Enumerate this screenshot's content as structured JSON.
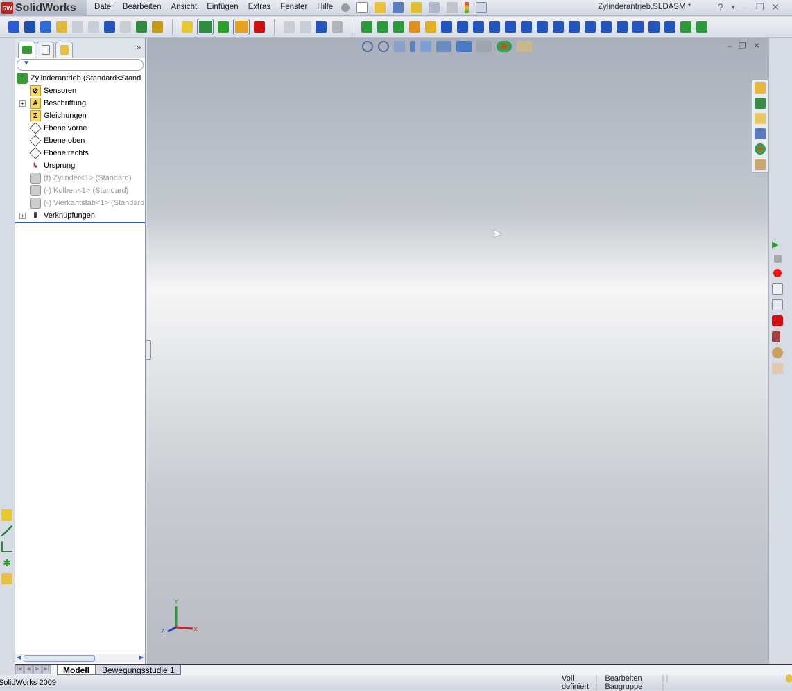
{
  "app": {
    "name": "SolidWorks",
    "logo": "SW",
    "document_title": "Zylinderantrieb.SLDASM *"
  },
  "menu": [
    "Datei",
    "Bearbeiten",
    "Ansicht",
    "Einfügen",
    "Extras",
    "Fenster",
    "Hilfe"
  ],
  "title_controls": {
    "help": "?",
    "minimize": "–",
    "maximize": "☐",
    "close": "✕"
  },
  "toolbar_icons": [
    {
      "name": "spell-check-icon",
      "color": "#2a5bd7"
    },
    {
      "name": "measure-icon",
      "color": "#1d4fb0"
    },
    {
      "name": "mass-properties-icon",
      "color": "#2f6ad9"
    },
    {
      "name": "section-properties-icon",
      "color": "#e0b83a"
    },
    {
      "name": "check-icon",
      "color": "#c8ccd4"
    },
    {
      "name": "costing-icon",
      "color": "#c8ccd4"
    },
    {
      "name": "sum-icon",
      "color": "#2355c0"
    },
    {
      "name": "interference-icon",
      "color": "#c8ccd4"
    },
    {
      "name": "bom-icon",
      "color": "#2f8b3f"
    },
    {
      "name": "analysis-icon",
      "color": "#c79a1a"
    },
    {
      "sep": true
    },
    {
      "name": "snap-icon",
      "color": "#e8c830"
    },
    {
      "name": "line-icon",
      "color": "#2f8b3f",
      "active": true
    },
    {
      "name": "point-icon",
      "color": "#2aa02a"
    },
    {
      "name": "sketch-icon",
      "color": "#e8a020",
      "active": true
    },
    {
      "name": "record-icon",
      "color": "#d01010"
    },
    {
      "sep": true
    },
    {
      "name": "filter-icon",
      "color": "#c8ccd4"
    },
    {
      "name": "filter-all-icon",
      "color": "#c8ccd4"
    },
    {
      "name": "filter-toggle-icon",
      "color": "#2355c0"
    },
    {
      "name": "select-icon",
      "color": "#b0b4bc"
    },
    {
      "sep": true
    },
    {
      "name": "filter-vertex-icon",
      "color": "#2a9a3a"
    },
    {
      "name": "filter-edge-icon",
      "color": "#2a9a3a"
    },
    {
      "name": "filter-face-icon",
      "color": "#2a9a3a"
    },
    {
      "name": "filter-surface-icon",
      "color": "#e09020"
    },
    {
      "name": "filter-body-icon",
      "color": "#e0b020"
    },
    {
      "name": "filter-axis-icon",
      "color": "#2355c0"
    },
    {
      "name": "filter-plane-icon",
      "color": "#2355c0"
    },
    {
      "name": "filter-point-icon",
      "color": "#2355c0"
    },
    {
      "name": "filter-dimension-icon",
      "color": "#2355c0"
    },
    {
      "name": "filter-note-icon",
      "color": "#2355c0"
    },
    {
      "name": "filter-balloon-icon",
      "color": "#2355c0"
    },
    {
      "name": "filter-weld-icon",
      "color": "#2355c0"
    },
    {
      "name": "filter-surface-finish-icon",
      "color": "#2355c0"
    },
    {
      "name": "filter-datum-icon",
      "color": "#2355c0"
    },
    {
      "name": "filter-gtol-icon",
      "color": "#2355c0"
    },
    {
      "name": "filter-cosmetic-thread-icon",
      "color": "#2355c0"
    },
    {
      "name": "filter-datum-target-icon",
      "color": "#2355c0"
    },
    {
      "name": "filter-dowel-icon",
      "color": "#2355c0"
    },
    {
      "name": "filter-block-icon",
      "color": "#2355c0"
    },
    {
      "name": "filter-center-mass-icon",
      "color": "#2355c0"
    },
    {
      "name": "filter-connection-point-icon",
      "color": "#2a9a3a"
    },
    {
      "name": "filter-routing-point-icon",
      "color": "#2a9a3a"
    }
  ],
  "tree": {
    "tabs": [
      "feature-manager-tab",
      "property-manager-tab",
      "configuration-manager-tab"
    ],
    "expand": "»",
    "filter": "▼",
    "root": "Zylinderantrieb  (Standard<Stand",
    "nodes": [
      {
        "label": "Sensoren",
        "icon": "sensor-folder-icon",
        "glyph": "⊘",
        "type": "folder"
      },
      {
        "label": "Beschriftung",
        "icon": "annotations-folder-icon",
        "glyph": "A",
        "type": "folder",
        "expandable": true
      },
      {
        "label": "Gleichungen",
        "icon": "equations-folder-icon",
        "glyph": "Σ",
        "type": "folder"
      },
      {
        "label": "Ebene vorne",
        "icon": "plane-icon",
        "type": "plane"
      },
      {
        "label": "Ebene oben",
        "icon": "plane-icon",
        "type": "plane"
      },
      {
        "label": "Ebene rechts",
        "icon": "plane-icon",
        "type": "plane"
      },
      {
        "label": "Ursprung",
        "icon": "origin-icon",
        "glyph": "↳",
        "type": "origin"
      },
      {
        "label": "(f) Zylinder<1> (Standard)",
        "icon": "part-icon",
        "type": "part",
        "grey": true
      },
      {
        "label": "(-) Kolben<1> (Standard)",
        "icon": "part-icon",
        "type": "part",
        "grey": true
      },
      {
        "label": "(-) Vierkantstab<1> (Standard",
        "icon": "part-icon",
        "type": "part",
        "grey": true
      },
      {
        "label": "Verknüpfungen",
        "icon": "mates-icon",
        "glyph": "⫴",
        "type": "mates",
        "expandable": true
      }
    ]
  },
  "viewport": {
    "triad": {
      "x": "X",
      "y": "Y",
      "z": "Z"
    },
    "controls": {
      "minimize": "–",
      "restore": "❐",
      "close": "✕"
    }
  },
  "bottom_tabs": {
    "active": "Modell",
    "other": "Bewegungsstudie 1"
  },
  "status": {
    "app": "SolidWorks 2009",
    "state": "Voll definiert",
    "mode": "Bearbeiten Baugruppe"
  }
}
